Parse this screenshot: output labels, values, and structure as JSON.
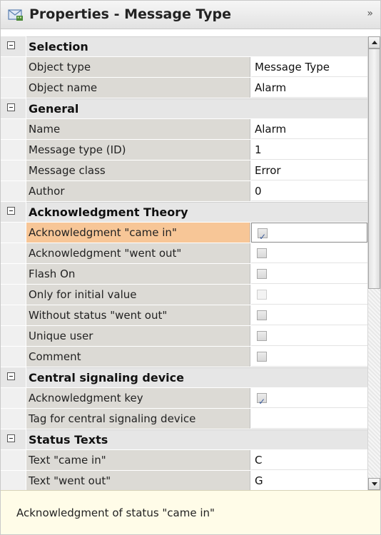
{
  "panel": {
    "title": "Properties - Message Type",
    "collapse_glyph": "»",
    "icon": "properties-icon"
  },
  "categories": [
    {
      "label": "Selection",
      "rows": [
        {
          "name": "Object type",
          "value": "Message Type"
        },
        {
          "name": "Object name",
          "value": "Alarm"
        }
      ]
    },
    {
      "label": "General",
      "rows": [
        {
          "name": "Name",
          "value": "Alarm"
        },
        {
          "name": "Message type (ID)",
          "value": "1"
        },
        {
          "name": "Message class",
          "value": "Error"
        },
        {
          "name": "Author",
          "value": "0"
        }
      ]
    },
    {
      "label": "Acknowledgment Theory",
      "rows": [
        {
          "name": "Acknowledgment \"came in\"",
          "checkbox": true,
          "checked": true,
          "selected": true
        },
        {
          "name": "Acknowledgment \"went out\"",
          "checkbox": true,
          "checked": false
        },
        {
          "name": "Flash On",
          "checkbox": true,
          "checked": false
        },
        {
          "name": "Only for initial value",
          "checkbox": true,
          "checked": false,
          "disabled": true
        },
        {
          "name": "Without status \"went out\"",
          "checkbox": true,
          "checked": false
        },
        {
          "name": "Unique user",
          "checkbox": true,
          "checked": false
        },
        {
          "name": "Comment",
          "checkbox": true,
          "checked": false
        }
      ]
    },
    {
      "label": "Central signaling device",
      "rows": [
        {
          "name": "Acknowledgment key",
          "checkbox": true,
          "checked": true
        },
        {
          "name": "Tag for central signaling device",
          "value": ""
        }
      ]
    },
    {
      "label": "Status Texts",
      "rows": [
        {
          "name": "Text \"came in\"",
          "value": "C"
        },
        {
          "name": "Text \"went out\"",
          "value": "G"
        }
      ]
    }
  ],
  "description": "Acknowledgment of status \"came in\"",
  "colors": {
    "selected_row": "#f7c697",
    "description_bg": "#fffce8",
    "category_bg": "#e6e6e6"
  }
}
